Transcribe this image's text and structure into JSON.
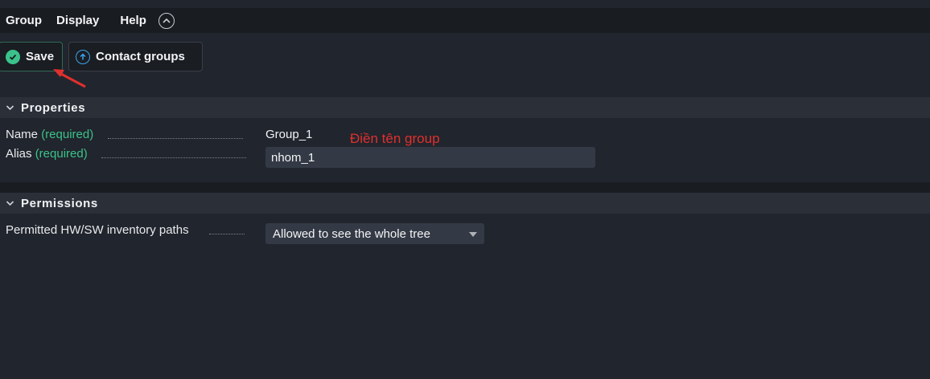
{
  "menubar": {
    "items": [
      "Group",
      "Display",
      "Help"
    ],
    "collapse_icon": "chevron-up-circle-icon"
  },
  "toolbar": {
    "save_label": "Save",
    "save_icon": "check-circle-icon",
    "contact_groups_label": "Contact groups",
    "contact_groups_icon": "arrow-up-circle-icon"
  },
  "properties": {
    "title": "Properties",
    "name": {
      "label": "Name",
      "required": "(required)",
      "value": "Group_1",
      "annotation": "Điền tên group"
    },
    "alias": {
      "label": "Alias",
      "required": "(required)",
      "value": "nhom_1"
    }
  },
  "permissions": {
    "title": "Permissions",
    "inventory": {
      "label": "Permitted HW/SW inventory paths",
      "selected": "Allowed to see the whole tree"
    }
  },
  "colors": {
    "required_green": "#3bc28a",
    "annotation_red": "#e0302e",
    "menubar_bg": "#191c21",
    "page_bg": "#21252d"
  }
}
